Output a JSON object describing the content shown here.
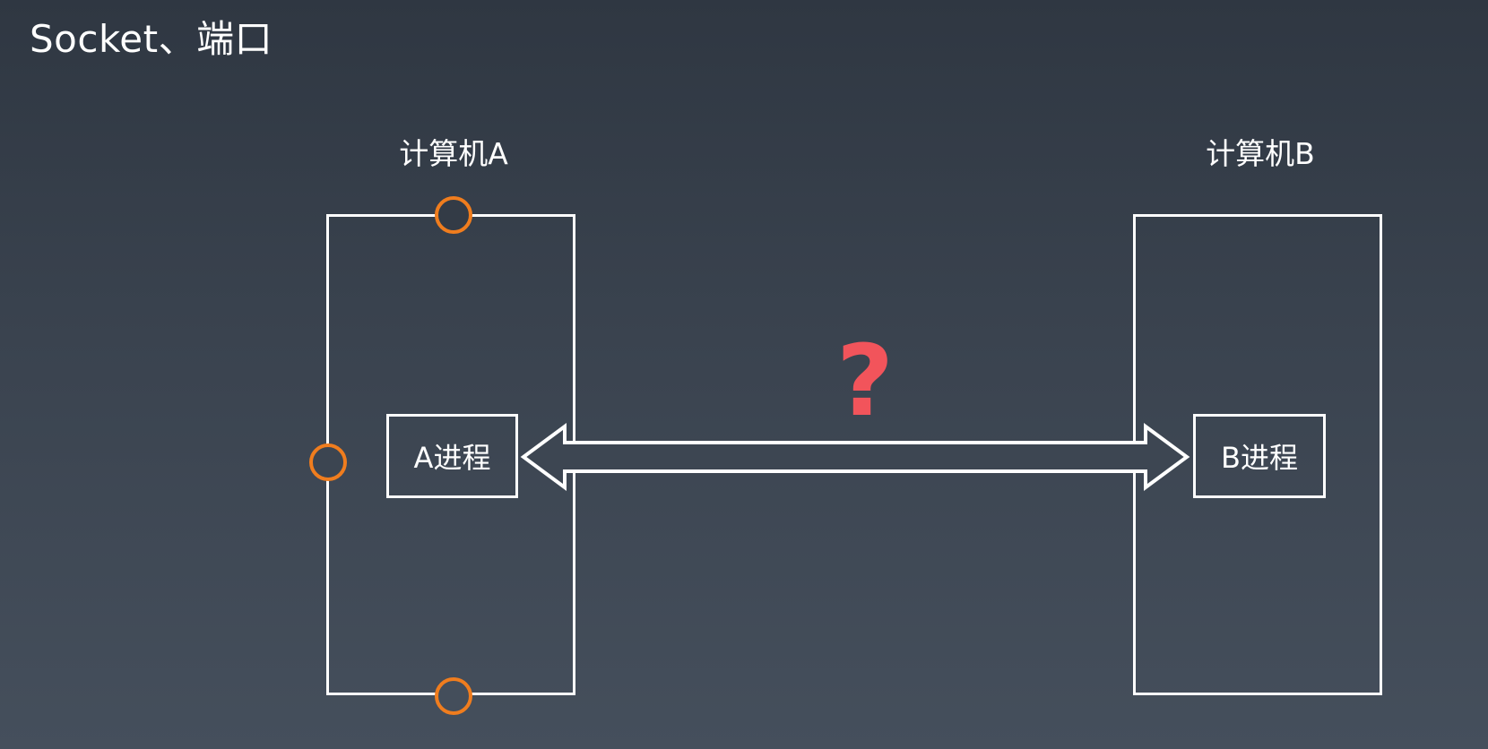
{
  "title": "Socket、端口",
  "computers": [
    {
      "label": "计算机A",
      "process": "A进程"
    },
    {
      "label": "计算机B",
      "process": "B进程"
    }
  ],
  "connection_symbol": "?",
  "colors": {
    "line": "#ffffff",
    "port": "#f07d1e",
    "question": "#f2545b"
  }
}
